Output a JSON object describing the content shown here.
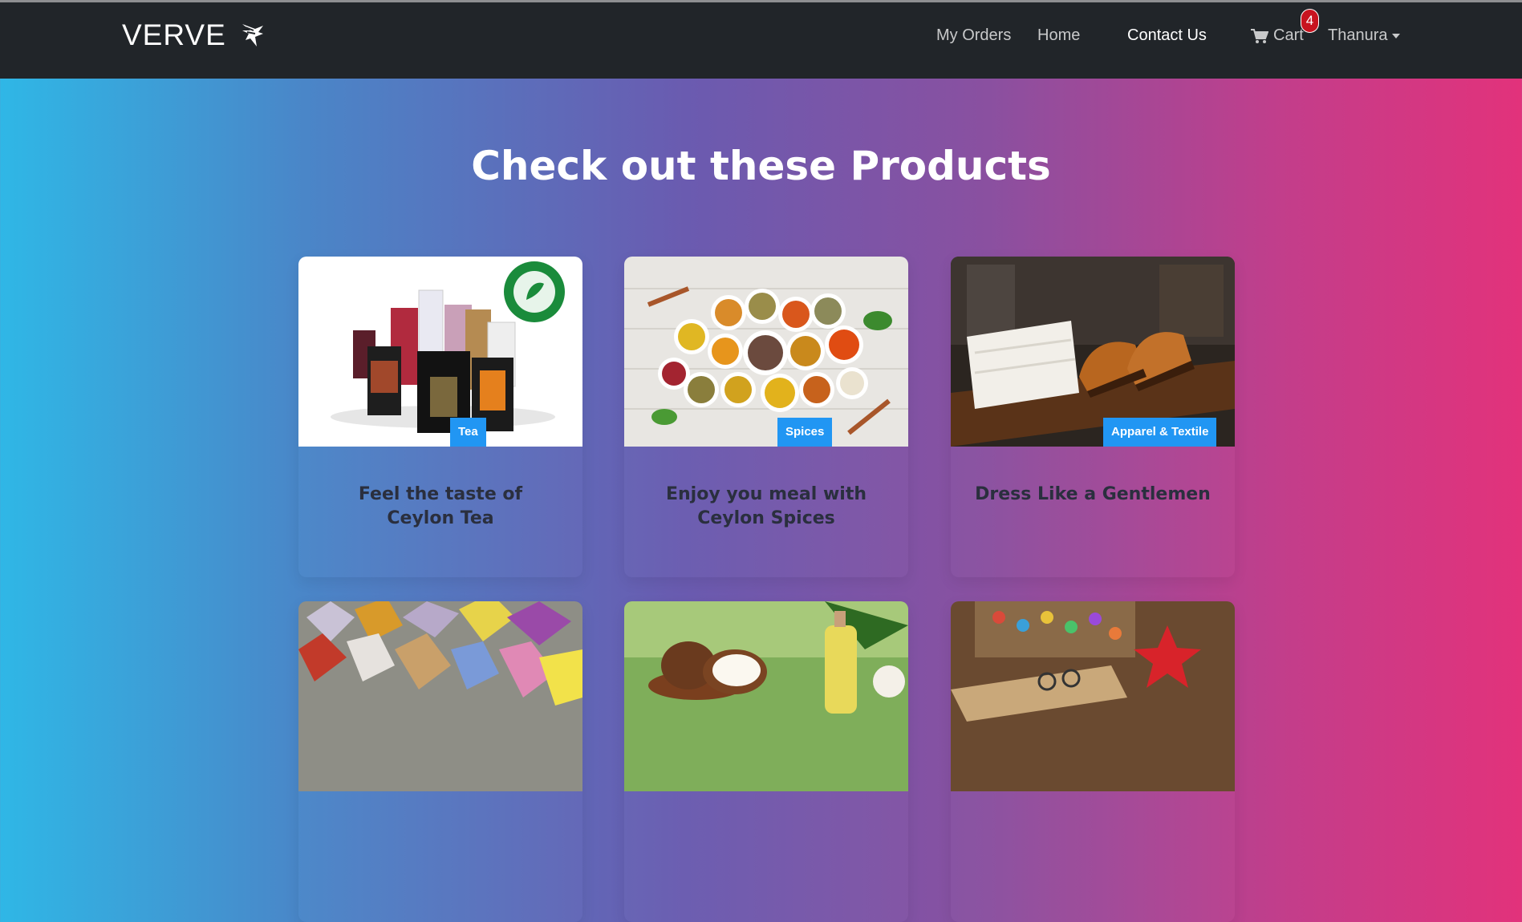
{
  "brand": {
    "name": "VERVE",
    "logo_icon": "bird-logo-icon"
  },
  "nav": {
    "my_orders": "My Orders",
    "home": "Home",
    "contact": "Contact Us",
    "cart": "Cart",
    "cart_count": "4",
    "user": "Thanura"
  },
  "heading": "Check out these Products",
  "products": [
    {
      "tag": "Tea",
      "title": "Feel the taste of Ceylon Tea"
    },
    {
      "tag": "Spices",
      "title": "Enjoy you meal with Ceylon Spices"
    },
    {
      "tag": "Apparel & Textile",
      "title": "Dress Like a Gentlemen"
    },
    {
      "tag": "",
      "title": ""
    },
    {
      "tag": "",
      "title": ""
    },
    {
      "tag": "",
      "title": ""
    }
  ],
  "colors": {
    "navbar": "#212529",
    "tag": "#2196f3",
    "badge": "#c8131f"
  }
}
